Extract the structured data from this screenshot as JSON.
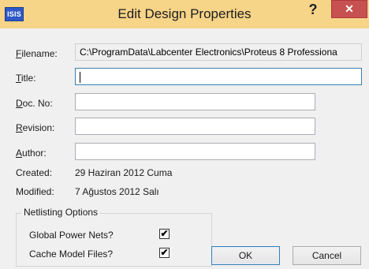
{
  "window": {
    "title": "Edit Design Properties",
    "app_icon_text": "ISIS",
    "help_label": "?",
    "close_label": "✕"
  },
  "fields": {
    "filename": {
      "label_first": "F",
      "label_rest": "ilename:",
      "value": "C:\\ProgramData\\Labcenter Electronics\\Proteus 8 Professiona"
    },
    "title": {
      "label_first": "T",
      "label_rest": "itle:",
      "value": ""
    },
    "doc_no": {
      "label_first": "D",
      "label_rest": "oc. No:",
      "value": ""
    },
    "revision": {
      "label_first": "R",
      "label_rest": "evision:",
      "value": ""
    },
    "author": {
      "label_first": "A",
      "label_rest": "uthor:",
      "value": ""
    }
  },
  "info": {
    "created_label": "Created:",
    "created_value": "29 Haziran 2012 Cuma",
    "modified_label": "Modified:",
    "modified_value": "7 Ağustos 2012 Salı"
  },
  "netlisting": {
    "title": "Netlisting Options",
    "options": [
      {
        "label": "Global Power Nets?",
        "checked": true
      },
      {
        "label": "Cache Model Files?",
        "checked": true
      }
    ],
    "check_glyph": "✔"
  },
  "buttons": {
    "ok": "OK",
    "cancel": "Cancel"
  }
}
